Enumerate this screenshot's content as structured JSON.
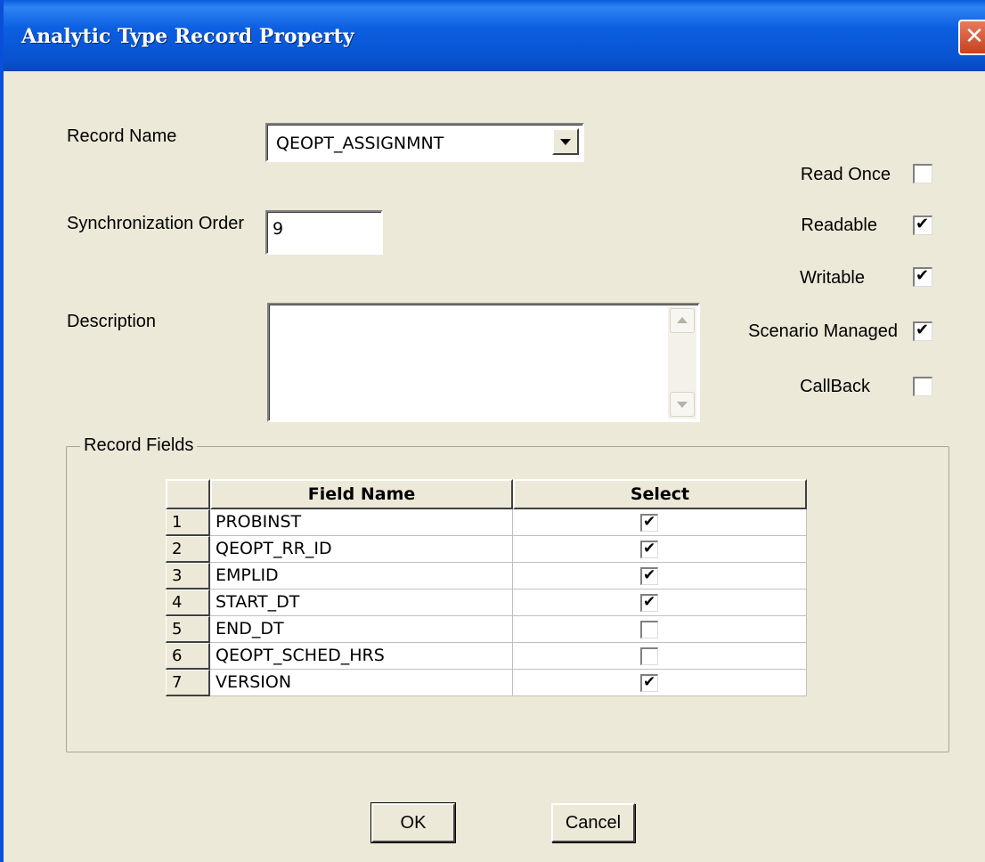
{
  "window": {
    "title": "Analytic Type Record Property",
    "close_label": "✕"
  },
  "form": {
    "record_name_label": "Record Name",
    "record_name_value": "QEOPT_ASSIGNMNT",
    "sync_order_label": "Synchronization Order",
    "sync_order_value": "9",
    "description_label": "Description",
    "description_value": ""
  },
  "properties": [
    {
      "label": "Read Once",
      "checked": false
    },
    {
      "label": "Readable",
      "checked": true
    },
    {
      "label": "Writable",
      "checked": true
    },
    {
      "label": "Scenario Managed",
      "checked": true
    },
    {
      "label": "CallBack",
      "checked": false
    }
  ],
  "record_fields": {
    "group_label": "Record Fields",
    "columns": [
      "Field Name",
      "Select"
    ],
    "rows": [
      {
        "num": "1",
        "field": "PROBINST",
        "selected": true
      },
      {
        "num": "2",
        "field": "QEOPT_RR_ID",
        "selected": true
      },
      {
        "num": "3",
        "field": "EMPLID",
        "selected": true
      },
      {
        "num": "4",
        "field": "START_DT",
        "selected": true
      },
      {
        "num": "5",
        "field": "END_DT",
        "selected": false
      },
      {
        "num": "6",
        "field": "QEOPT_SCHED_HRS",
        "selected": false
      },
      {
        "num": "7",
        "field": "VERSION",
        "selected": true
      }
    ]
  },
  "buttons": {
    "ok": "OK",
    "cancel": "Cancel"
  },
  "colors": {
    "titlebar": "#0a5bd8",
    "dialog_bg": "#ece9d8",
    "close": "#d9542f"
  }
}
